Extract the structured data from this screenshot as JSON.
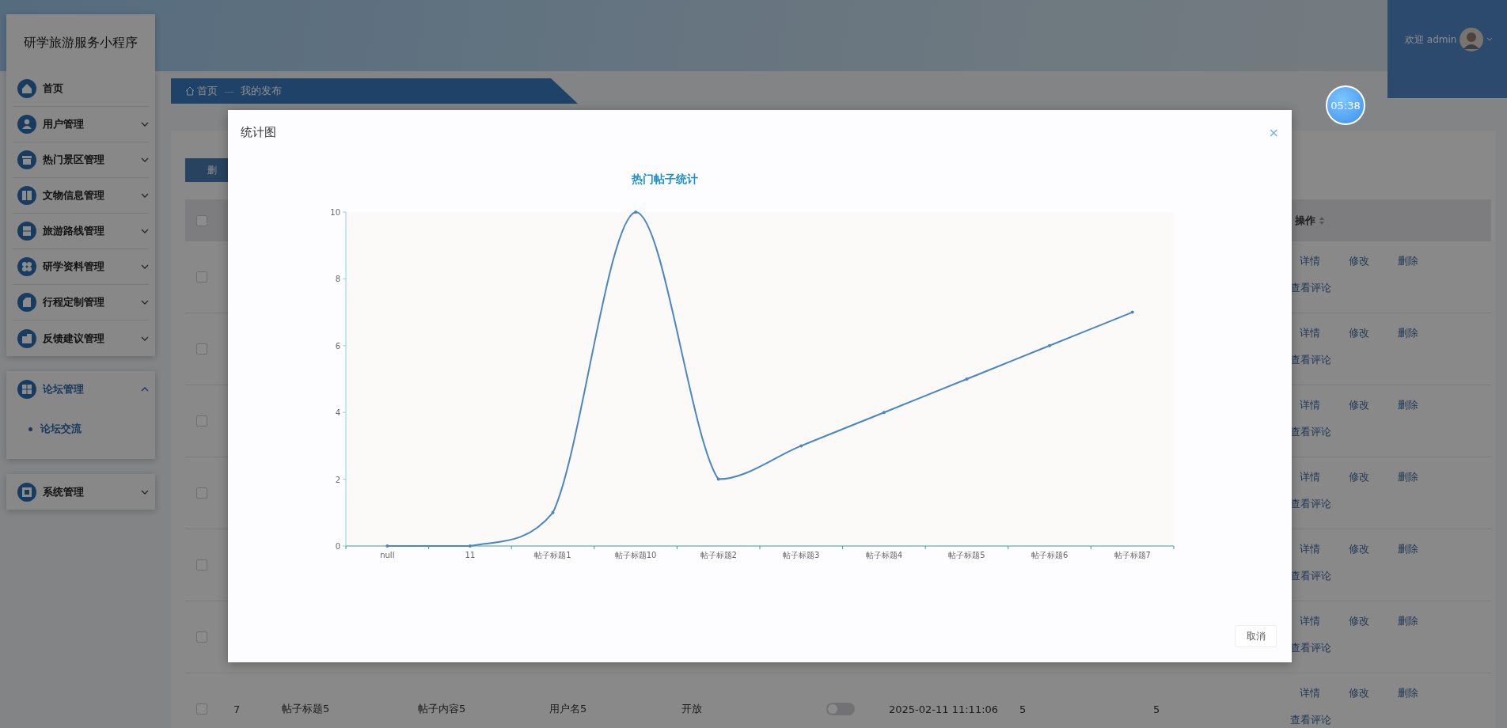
{
  "header": {
    "welcome": "欢迎 admin"
  },
  "sidebar": {
    "title": "研学旅游服务小程序",
    "groups": [
      {
        "items": [
          {
            "label": "首页",
            "kind": "link"
          },
          {
            "label": "用户管理",
            "kind": "submenu",
            "expanded": false
          },
          {
            "label": "热门景区管理",
            "kind": "submenu",
            "expanded": false
          },
          {
            "label": "文物信息管理",
            "kind": "submenu",
            "expanded": false
          },
          {
            "label": "旅游路线管理",
            "kind": "submenu",
            "expanded": false
          },
          {
            "label": "研学资料管理",
            "kind": "submenu",
            "expanded": false
          },
          {
            "label": "行程定制管理",
            "kind": "submenu",
            "expanded": false
          },
          {
            "label": "反馈建议管理",
            "kind": "submenu",
            "expanded": false
          }
        ]
      },
      {
        "items": [
          {
            "label": "论坛管理",
            "kind": "submenu",
            "expanded": true,
            "children": [
              {
                "label": "论坛交流",
                "selected": true
              }
            ]
          }
        ]
      },
      {
        "items": [
          {
            "label": "系统管理",
            "kind": "submenu",
            "expanded": false
          }
        ]
      }
    ]
  },
  "breadcrumb": {
    "home": "首页",
    "separator": "—",
    "current": "我的发布"
  },
  "timer": "05:38",
  "toolbar": {
    "delete": "删"
  },
  "table": {
    "header": {
      "checked": false,
      "actions_label": "操作"
    },
    "rows": [
      {
        "checked": false,
        "actions": [
          "详情",
          "修改",
          "删除",
          "查看评论"
        ]
      },
      {
        "checked": false,
        "actions": [
          "详情",
          "修改",
          "删除",
          "查看评论"
        ]
      },
      {
        "checked": false,
        "actions": [
          "详情",
          "修改",
          "删除",
          "查看评论"
        ]
      },
      {
        "checked": false,
        "actions": [
          "详情",
          "修改",
          "删除",
          "查看评论"
        ]
      },
      {
        "checked": false,
        "actions": [
          "详情",
          "修改",
          "删除",
          "查看评论"
        ]
      },
      {
        "checked": false,
        "actions": [
          "详情",
          "修改",
          "删除",
          "查看评论"
        ]
      },
      {
        "checked": false,
        "cells": [
          "7",
          "帖子标题5",
          "帖子内容5",
          "用户名5",
          "开放"
        ],
        "toggle": {
          "on": false
        },
        "cells_after": [
          "2025-02-11 11:11:06",
          "5",
          "5"
        ],
        "actions": [
          "详情",
          "修改",
          "删除",
          "查看评论"
        ]
      }
    ]
  },
  "dialog": {
    "title": "统计图",
    "close": "×",
    "cancel": "取消",
    "chart_data": {
      "type": "line",
      "title": "热门帖子统计",
      "categories": [
        "null",
        "11",
        "帖子标题1",
        "帖子标题10",
        "帖子标题2",
        "帖子标题3",
        "帖子标题4",
        "帖子标题5",
        "帖子标题6",
        "帖子标题7"
      ],
      "series": [
        {
          "color": "#4a86c0",
          "values": [
            0,
            0,
            1,
            10,
            2,
            3,
            4,
            5,
            6,
            7
          ]
        }
      ],
      "ylim": [
        0,
        10
      ],
      "yticks": [
        0,
        2,
        4,
        6,
        8,
        10
      ]
    }
  }
}
